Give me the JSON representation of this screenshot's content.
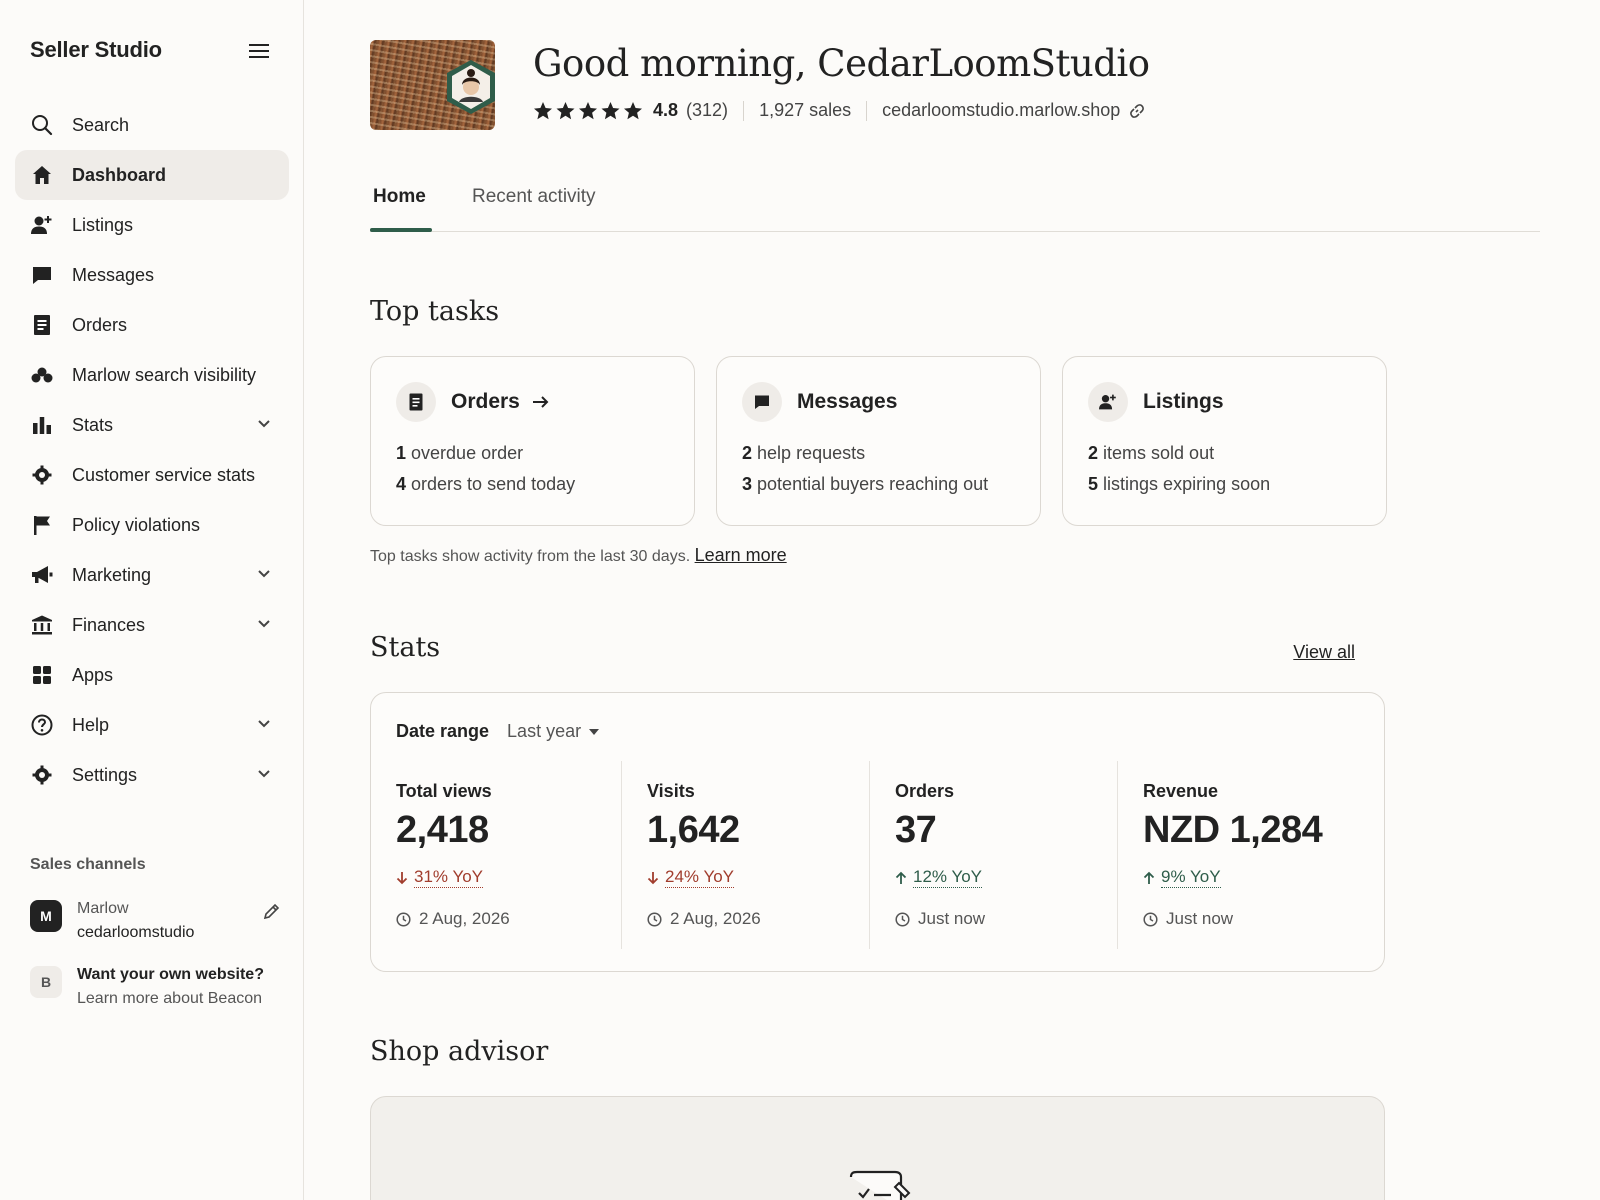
{
  "sidebar": {
    "brand": "Seller Studio",
    "items": [
      {
        "label": "Search",
        "icon": "search-icon"
      },
      {
        "label": "Dashboard",
        "icon": "home-icon",
        "active": true
      },
      {
        "label": "Listings",
        "icon": "person-add-icon"
      },
      {
        "label": "Messages",
        "icon": "message-icon"
      },
      {
        "label": "Orders",
        "icon": "document-icon"
      },
      {
        "label": "Marlow search visibility",
        "icon": "visibility-icon"
      },
      {
        "label": "Stats",
        "icon": "bar-chart-icon",
        "expandable": true
      },
      {
        "label": "Customer service stats",
        "icon": "gear-icon"
      },
      {
        "label": "Policy violations",
        "icon": "flag-icon"
      },
      {
        "label": "Marketing",
        "icon": "megaphone-icon",
        "expandable": true
      },
      {
        "label": "Finances",
        "icon": "bank-icon",
        "expandable": true
      },
      {
        "label": "Apps",
        "icon": "grid-icon"
      },
      {
        "label": "Help",
        "icon": "help-icon",
        "expandable": true
      },
      {
        "label": "Settings",
        "icon": "gear-icon",
        "expandable": true
      }
    ],
    "sales_channels": {
      "title": "Sales channels",
      "marlow": {
        "badge": "M",
        "name": "Marlow",
        "shop": "cedarloomstudio"
      },
      "beacon": {
        "badge": "B",
        "title": "Want your own website?",
        "subtitle": "Learn more about Beacon"
      }
    }
  },
  "header": {
    "greeting": "Good morning, CedarLoomStudio",
    "rating": "4.8",
    "reviews": "(312)",
    "sales": "1,927 sales",
    "shop_url": "cedarloomstudio.marlow.shop",
    "stars": 5
  },
  "tabs": [
    {
      "label": "Home",
      "active": true
    },
    {
      "label": "Recent activity"
    }
  ],
  "top_tasks": {
    "title": "Top tasks",
    "cards": [
      {
        "title": "Orders",
        "icon": "document-icon",
        "arrow": true,
        "lines": [
          {
            "count": "1",
            "text": "overdue order"
          },
          {
            "count": "4",
            "text": "orders to send today"
          }
        ]
      },
      {
        "title": "Messages",
        "icon": "message-icon",
        "lines": [
          {
            "count": "2",
            "text": "help requests"
          },
          {
            "count": "3",
            "text": "potential buyers reaching out"
          }
        ]
      },
      {
        "title": "Listings",
        "icon": "person-add-icon",
        "lines": [
          {
            "count": "2",
            "text": "items sold out"
          },
          {
            "count": "5",
            "text": "listings expiring soon"
          }
        ]
      }
    ],
    "note": "Top tasks show activity from the last 30 days.",
    "learn_more": "Learn more"
  },
  "stats": {
    "title": "Stats",
    "view_all": "View all",
    "date_range_label": "Date range",
    "date_range_value": "Last year",
    "metrics": [
      {
        "label": "Total views",
        "value": "2,418",
        "change": "31% YoY",
        "direction": "down",
        "time": "2 Aug, 2026"
      },
      {
        "label": "Visits",
        "value": "1,642",
        "change": "24% YoY",
        "direction": "down",
        "time": "2 Aug, 2026"
      },
      {
        "label": "Orders",
        "value": "37",
        "change": "12% YoY",
        "direction": "up",
        "time": "Just now"
      },
      {
        "label": "Revenue",
        "value": "NZD 1,284",
        "change": "9% YoY",
        "direction": "up",
        "time": "Just now"
      }
    ]
  },
  "shop_advisor": {
    "title": "Shop advisor"
  },
  "colors": {
    "accent": "#2f5d4a",
    "negative": "#a13d2d",
    "active_bg": "#efece8"
  }
}
